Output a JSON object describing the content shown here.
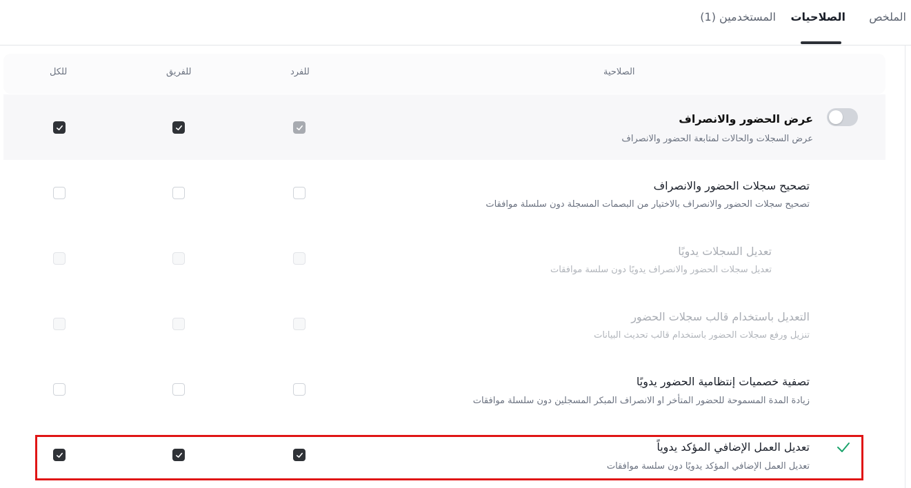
{
  "tabs": [
    {
      "label": "الملخص",
      "active": false
    },
    {
      "label": "الصلاحيات",
      "active": true
    },
    {
      "label": "المستخدمين (1)",
      "active": false
    }
  ],
  "table_header": {
    "permission": "الصلاحية",
    "individual": "للفرد",
    "team": "للفريق",
    "all": "للكل"
  },
  "section": {
    "title": "عرض الحضور والانصراف",
    "description": "عرض السجلات والحالات لمتابعة الحضور والانصراف",
    "toggle_on": false,
    "individual": "checked-disabled",
    "team": "checked",
    "all": "checked"
  },
  "permissions": [
    {
      "title": "تصحيح سجلات الحضور والانصراف",
      "description": "تصحيح سجلات الحضور والانصراف بالاختيار من البصمات المسجلة دون سلسلة موافقات",
      "disabled": false,
      "individual": false,
      "team": false,
      "all": false
    },
    {
      "title": "تعديل السجلات يدويًا",
      "description": "تعديل سجلات الحضور والانصراف يدويًا دون سلسة موافقات",
      "disabled": true,
      "individual": false,
      "team": false,
      "all": false
    },
    {
      "title": "التعديل باستخدام قالب سجلات الحضور",
      "description": "تنزيل ورفع سجلات الحضور باستخدام قالب تحديث البيانات",
      "disabled": true,
      "individual": false,
      "team": false,
      "all": false
    },
    {
      "title": "تصفية خصميات إنتظامية الحضور يدويًا",
      "description": "زيادة المدة المسموحة للحضور المتأخر او الانصراف المبكر المسجلين دون سلسلة موافقات",
      "disabled": false,
      "individual": false,
      "team": false,
      "all": false
    },
    {
      "title": "تعديل العمل الإضافي المؤكد يدوياً",
      "description": "تعديل العمل الإضافي المؤكد يدويًا دون سلسة موافقات",
      "disabled": false,
      "individual": true,
      "team": true,
      "all": true,
      "saved": true
    }
  ],
  "colors": {
    "highlight": "#e01515",
    "success_check": "#1aa36b",
    "checkbox_checked": "#2f3237"
  },
  "icons": {
    "toggle": "toggle-switch-off",
    "checked": "check-icon",
    "saved": "green-check-icon"
  }
}
